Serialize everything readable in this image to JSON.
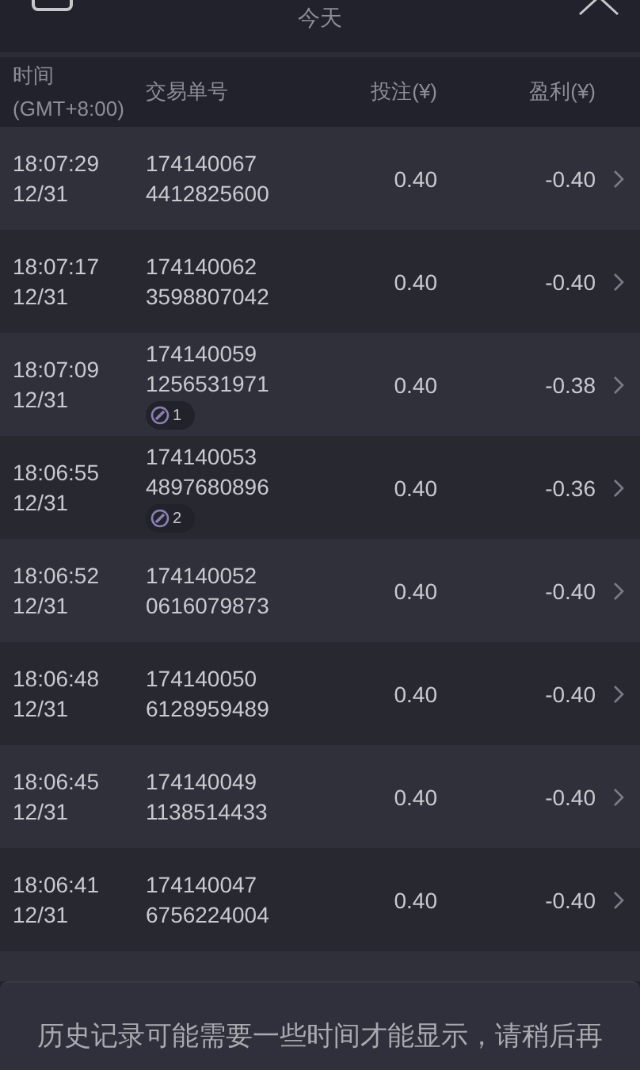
{
  "header": {
    "title": "今天"
  },
  "columns": [
    "时间",
    "(GMT+8:00)",
    "交易单号",
    "投注(¥)",
    "盈利(¥)"
  ],
  "rows": [
    {
      "time": "18:07:29",
      "date": "12/31",
      "order_1": "174140067",
      "order_2": "4412825600",
      "bet": "0.40",
      "profit": "-0.40"
    },
    {
      "time": "18:07:17",
      "date": "12/31",
      "order_1": "174140062",
      "order_2": "3598807042",
      "bet": "0.40",
      "profit": "-0.40"
    },
    {
      "time": "18:07:09",
      "date": "12/31",
      "order_1": "174140059",
      "order_2": "1256531971",
      "badge": "1",
      "bet": "0.40",
      "profit": "-0.38"
    },
    {
      "time": "18:06:55",
      "date": "12/31",
      "order_1": "174140053",
      "order_2": "4897680896",
      "badge": "2",
      "bet": "0.40",
      "profit": "-0.36"
    },
    {
      "time": "18:06:52",
      "date": "12/31",
      "order_1": "174140052",
      "order_2": "0616079873",
      "bet": "0.40",
      "profit": "-0.40"
    },
    {
      "time": "18:06:48",
      "date": "12/31",
      "order_1": "174140050",
      "order_2": "6128959489",
      "bet": "0.40",
      "profit": "-0.40"
    },
    {
      "time": "18:06:45",
      "date": "12/31",
      "order_1": "174140049",
      "order_2": "1138514433",
      "bet": "0.40",
      "profit": "-0.40"
    },
    {
      "time": "18:06:41",
      "date": "12/31",
      "order_1": "174140047",
      "order_2": "6756224004",
      "bet": "0.40",
      "profit": "-0.40"
    }
  ],
  "notice": "历史记录可能需要一些时间才能显示，请稍后再"
}
